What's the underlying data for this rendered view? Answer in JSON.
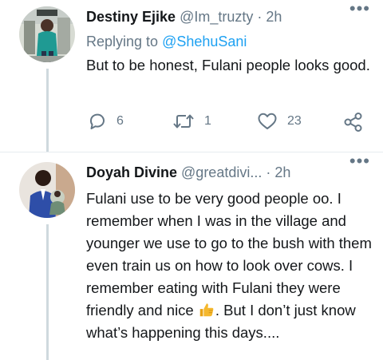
{
  "tweets": [
    {
      "name": "Destiny Ejike",
      "handle": "@Im_truzty",
      "separator": "·",
      "time": "2h",
      "more": "•••",
      "replying_prefix": "Replying to ",
      "replying_mention": "@ShehuSani",
      "text": "But to be honest, Fulani people looks good.",
      "actions": {
        "replies": "6",
        "retweets": "1",
        "likes": "23"
      }
    },
    {
      "name": "Doyah Divine",
      "handle": "@greatdivi...",
      "separator": "·",
      "time": "2h",
      "more": "•••",
      "text_before_emoji": "Fulani use to be very good people oo. I remember when I was in the village and younger we use to go to the bush with them even train us on how to look over cows. I remember eating with Fulani they were friendly and nice ",
      "text_after_emoji": ". But I don’t just know what’s happening this days...."
    }
  ],
  "icons": {
    "more": "more-dots-icon",
    "reply": "reply-bubble-icon",
    "retweet": "retweet-icon",
    "like": "heart-icon",
    "share": "share-icon",
    "emoji": "thumbs-up-emoji"
  },
  "colors": {
    "text": "#14171a",
    "secondary": "#657786",
    "link": "#1da1f2",
    "thread_line": "#cfd9de",
    "divider": "#e6ecf0",
    "emoji": "#f5b82e"
  }
}
